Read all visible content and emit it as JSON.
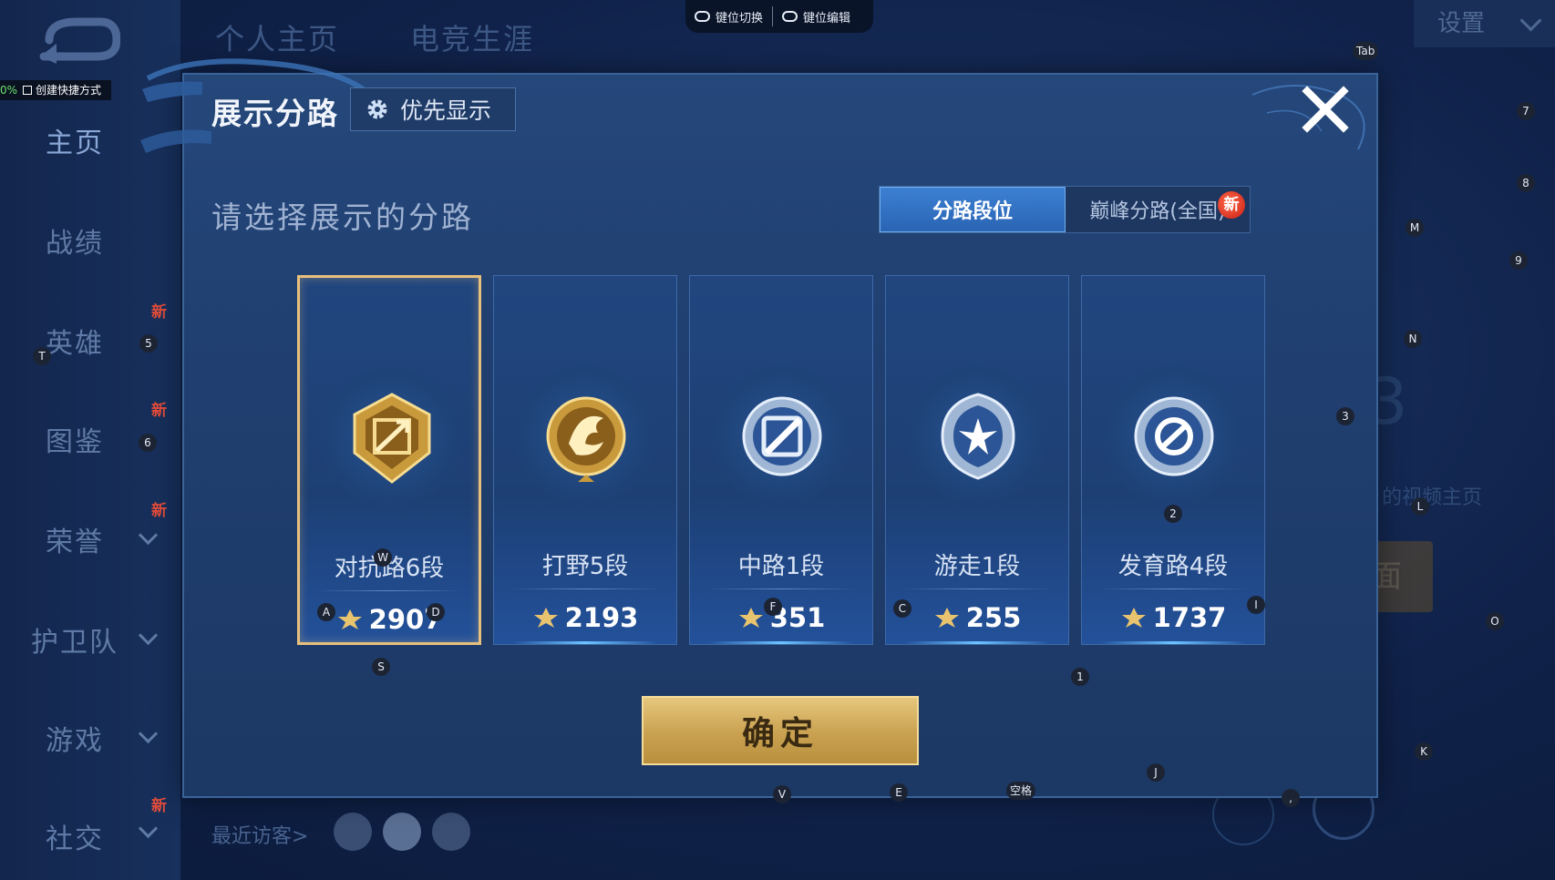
{
  "background": {
    "top_tabs": [
      "个人主页",
      "电竞生涯"
    ],
    "settings_label": "设置",
    "nav_items": [
      {
        "label": "主页"
      },
      {
        "label": "战绩"
      },
      {
        "label": "英雄",
        "badge": "新"
      },
      {
        "label": "图鉴",
        "badge": "新"
      },
      {
        "label": "荣誉",
        "badge": "新"
      },
      {
        "label": "护卫队"
      },
      {
        "label": "游戏"
      },
      {
        "label": "社交",
        "badge": "新"
      }
    ],
    "visitors_label": "最近访客>",
    "video_text": "的视频主页",
    "side_button_text": "面",
    "big_digit": "3"
  },
  "toolbar": {
    "key_switch": "键位切换",
    "key_edit": "键位编辑",
    "shortcut_pct": "0%",
    "shortcut_label": "创建快捷方式"
  },
  "dialog": {
    "title": "展示分路",
    "priority_button": "优先显示",
    "subtitle": "请选择展示的分路",
    "tabs": [
      {
        "label": "分路段位",
        "active": true
      },
      {
        "label": "巅峰分路(全国)",
        "active": false
      }
    ],
    "new_badge": "新",
    "confirm_label": "确定",
    "cards": [
      {
        "name": "对抗路6段",
        "score": "2907",
        "selected": true,
        "emblem": "gold-crossed-swords-emblem"
      },
      {
        "name": "打野5段",
        "score": "2193",
        "selected": false,
        "emblem": "gold-dragon-emblem"
      },
      {
        "name": "中路1段",
        "score": "351",
        "selected": false,
        "emblem": "silver-slash-emblem"
      },
      {
        "name": "游走1段",
        "score": "255",
        "selected": false,
        "emblem": "silver-wings-emblem"
      },
      {
        "name": "发育路4段",
        "score": "1737",
        "selected": false,
        "emblem": "silver-ring-emblem"
      }
    ]
  },
  "key_hints": [
    "Tab",
    "7",
    "8",
    "M",
    "9",
    "N",
    "3",
    "L",
    "I",
    "O",
    "K",
    "J",
    "1",
    "2",
    "C",
    "F",
    "A",
    "D",
    "W",
    "S",
    "V",
    "E",
    "空格",
    "5",
    "6",
    "T",
    ","
  ],
  "colors": {
    "accent_gold": "#e8c07e",
    "tab_active": "#3c80d2",
    "confirm_gold": "#c9a150",
    "new_red": "#c91d14"
  }
}
